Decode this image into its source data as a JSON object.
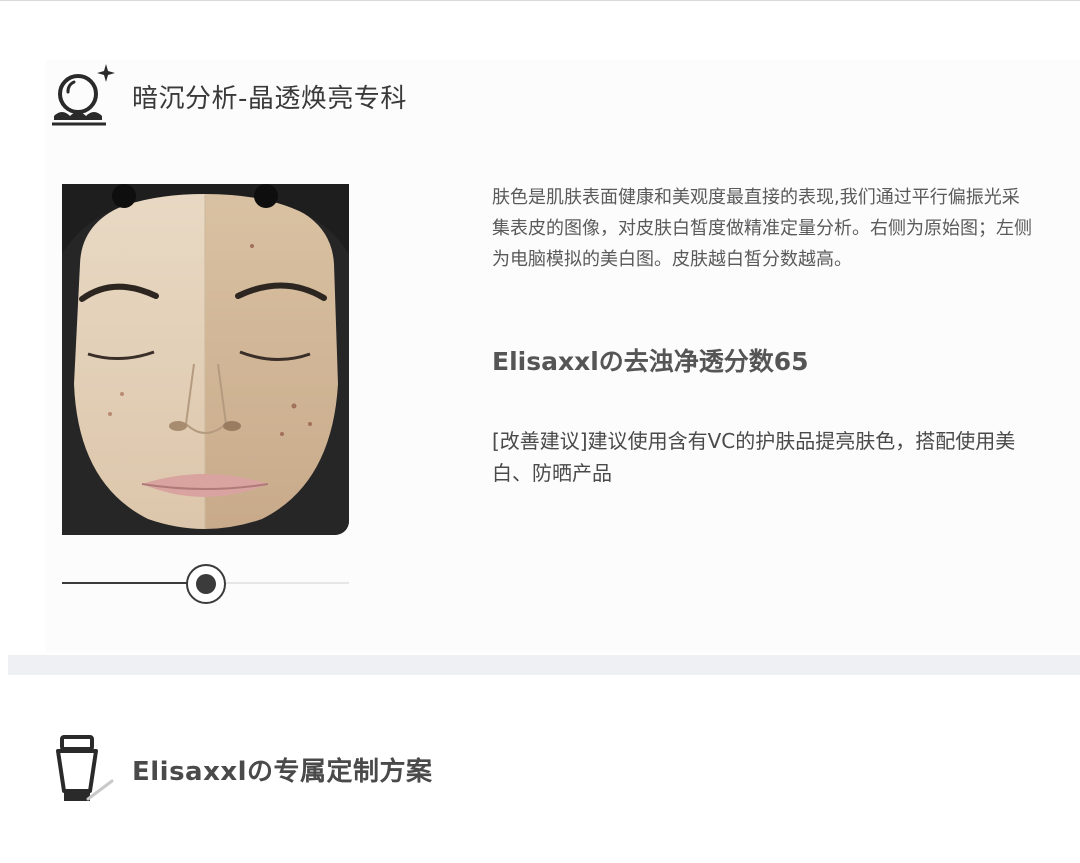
{
  "section1": {
    "icon": "pearl-sparkle-icon",
    "title": "暗沉分析-晶透焕亮专科",
    "description": "肤色是肌肤表面健康和美观度最直接的表现,我们通过平行偏振光采集表皮的图像，对皮肤白皙度做精准定量分析。右侧为原始图；左侧为电脑模拟的美白图。皮肤越白皙分数越高。",
    "score_text": "Elisaxxlの去浊净透分数65",
    "advice": "[改善建议]建议使用含有VC的护肤品提亮肤色，搭配使用美白、防晒产品",
    "comparison_slider": {
      "value": 0.5
    }
  },
  "section2": {
    "icon": "cream-tube-icon",
    "title": "Elisaxxlの专属定制方案"
  }
}
